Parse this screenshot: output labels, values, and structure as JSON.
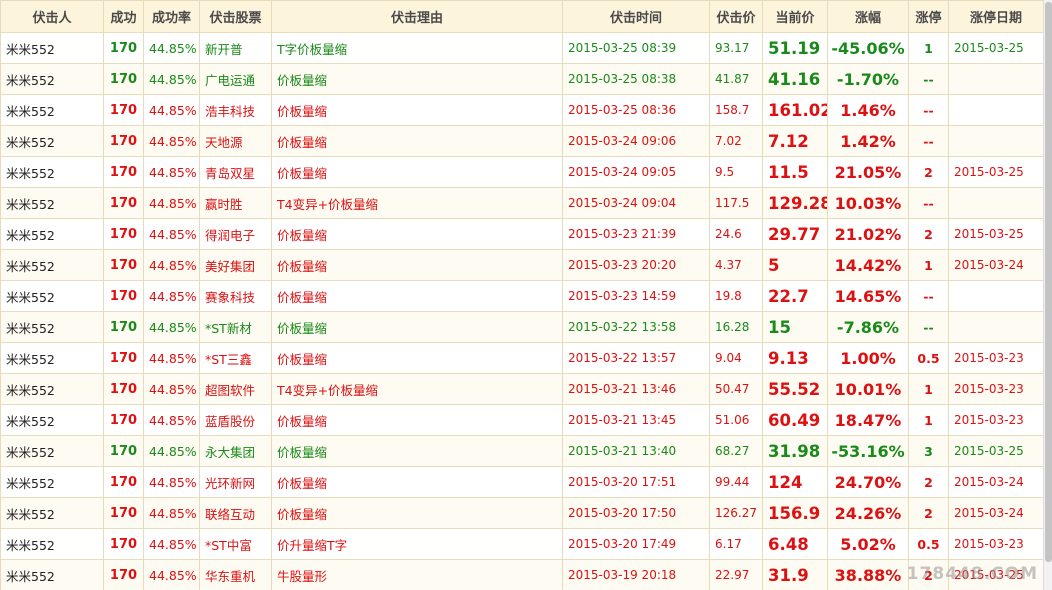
{
  "headers": [
    "伏击人",
    "成功",
    "成功率",
    "伏击股票",
    "伏击理由",
    "伏击时间",
    "伏击价",
    "当前价",
    "涨幅",
    "涨停",
    "涨停日期"
  ],
  "rows": [
    {
      "trend": "down",
      "user": "米米552",
      "success": "170",
      "rate": "44.85%",
      "stock": "新开普",
      "reason": "T字价板量缩",
      "time": "2015-03-25 08:39",
      "price": "93.17",
      "current": "51.19",
      "change": "-45.06%",
      "limit": "1",
      "limit_date": "2015-03-25"
    },
    {
      "trend": "down",
      "user": "米米552",
      "success": "170",
      "rate": "44.85%",
      "stock": "广电运通",
      "reason": "价板量缩",
      "time": "2015-03-25 08:38",
      "price": "41.87",
      "current": "41.16",
      "change": "-1.70%",
      "limit": "--",
      "limit_date": ""
    },
    {
      "trend": "up",
      "user": "米米552",
      "success": "170",
      "rate": "44.85%",
      "stock": "浩丰科技",
      "reason": "价板量缩",
      "time": "2015-03-25 08:36",
      "price": "158.7",
      "current": "161.02",
      "change": "1.46%",
      "limit": "--",
      "limit_date": ""
    },
    {
      "trend": "up",
      "user": "米米552",
      "success": "170",
      "rate": "44.85%",
      "stock": "天地源",
      "reason": "价板量缩",
      "time": "2015-03-24 09:06",
      "price": "7.02",
      "current": "7.12",
      "change": "1.42%",
      "limit": "--",
      "limit_date": ""
    },
    {
      "trend": "up",
      "user": "米米552",
      "success": "170",
      "rate": "44.85%",
      "stock": "青岛双星",
      "reason": "价板量缩",
      "time": "2015-03-24 09:05",
      "price": "9.5",
      "current": "11.5",
      "change": "21.05%",
      "limit": "2",
      "limit_date": "2015-03-25"
    },
    {
      "trend": "up",
      "user": "米米552",
      "success": "170",
      "rate": "44.85%",
      "stock": "赢时胜",
      "reason": "T4变异+价板量缩",
      "time": "2015-03-24 09:04",
      "price": "117.5",
      "current": "129.28",
      "change": "10.03%",
      "limit": "--",
      "limit_date": ""
    },
    {
      "trend": "up",
      "user": "米米552",
      "success": "170",
      "rate": "44.85%",
      "stock": "得润电子",
      "reason": "价板量缩",
      "time": "2015-03-23 21:39",
      "price": "24.6",
      "current": "29.77",
      "change": "21.02%",
      "limit": "2",
      "limit_date": "2015-03-25"
    },
    {
      "trend": "up",
      "user": "米米552",
      "success": "170",
      "rate": "44.85%",
      "stock": "美好集团",
      "reason": "价板量缩",
      "time": "2015-03-23 20:20",
      "price": "4.37",
      "current": "5",
      "change": "14.42%",
      "limit": "1",
      "limit_date": "2015-03-24"
    },
    {
      "trend": "up",
      "user": "米米552",
      "success": "170",
      "rate": "44.85%",
      "stock": "赛象科技",
      "reason": "价板量缩",
      "time": "2015-03-23 14:59",
      "price": "19.8",
      "current": "22.7",
      "change": "14.65%",
      "limit": "--",
      "limit_date": ""
    },
    {
      "trend": "down",
      "user": "米米552",
      "success": "170",
      "rate": "44.85%",
      "stock": "*ST新材",
      "reason": "价板量缩",
      "time": "2015-03-22 13:58",
      "price": "16.28",
      "current": "15",
      "change": "-7.86%",
      "limit": "--",
      "limit_date": ""
    },
    {
      "trend": "up",
      "user": "米米552",
      "success": "170",
      "rate": "44.85%",
      "stock": "*ST三鑫",
      "reason": "价板量缩",
      "time": "2015-03-22 13:57",
      "price": "9.04",
      "current": "9.13",
      "change": "1.00%",
      "limit": "0.5",
      "limit_date": "2015-03-23"
    },
    {
      "trend": "up",
      "user": "米米552",
      "success": "170",
      "rate": "44.85%",
      "stock": "超图软件",
      "reason": "T4变异+价板量缩",
      "time": "2015-03-21 13:46",
      "price": "50.47",
      "current": "55.52",
      "change": "10.01%",
      "limit": "1",
      "limit_date": "2015-03-23"
    },
    {
      "trend": "up",
      "user": "米米552",
      "success": "170",
      "rate": "44.85%",
      "stock": "蓝盾股份",
      "reason": "价板量缩",
      "time": "2015-03-21 13:45",
      "price": "51.06",
      "current": "60.49",
      "change": "18.47%",
      "limit": "1",
      "limit_date": "2015-03-23"
    },
    {
      "trend": "down",
      "user": "米米552",
      "success": "170",
      "rate": "44.85%",
      "stock": "永大集团",
      "reason": "价板量缩",
      "time": "2015-03-21 13:40",
      "price": "68.27",
      "current": "31.98",
      "change": "-53.16%",
      "limit": "3",
      "limit_date": "2015-03-25"
    },
    {
      "trend": "up",
      "user": "米米552",
      "success": "170",
      "rate": "44.85%",
      "stock": "光环新网",
      "reason": "价板量缩",
      "time": "2015-03-20 17:51",
      "price": "99.44",
      "current": "124",
      "change": "24.70%",
      "limit": "2",
      "limit_date": "2015-03-24"
    },
    {
      "trend": "up",
      "user": "米米552",
      "success": "170",
      "rate": "44.85%",
      "stock": "联络互动",
      "reason": "价板量缩",
      "time": "2015-03-20 17:50",
      "price": "126.27",
      "current": "156.9",
      "change": "24.26%",
      "limit": "2",
      "limit_date": "2015-03-24"
    },
    {
      "trend": "up",
      "user": "米米552",
      "success": "170",
      "rate": "44.85%",
      "stock": "*ST中富",
      "reason": "价升量缩T字",
      "time": "2015-03-20 17:49",
      "price": "6.17",
      "current": "6.48",
      "change": "5.02%",
      "limit": "0.5",
      "limit_date": "2015-03-23"
    },
    {
      "trend": "up",
      "user": "米米552",
      "success": "170",
      "rate": "44.85%",
      "stock": "华东重机",
      "reason": "牛股量形",
      "time": "2015-03-19 20:18",
      "price": "22.97",
      "current": "31.9",
      "change": "38.88%",
      "limit": "2",
      "limit_date": "2015-03-25"
    }
  ],
  "watermark": "178448.COM",
  "colors": {
    "up": "#dd1111",
    "down": "#1a8a1a",
    "header_bg": "#fdf4dc",
    "border": "#e6dcbc"
  }
}
